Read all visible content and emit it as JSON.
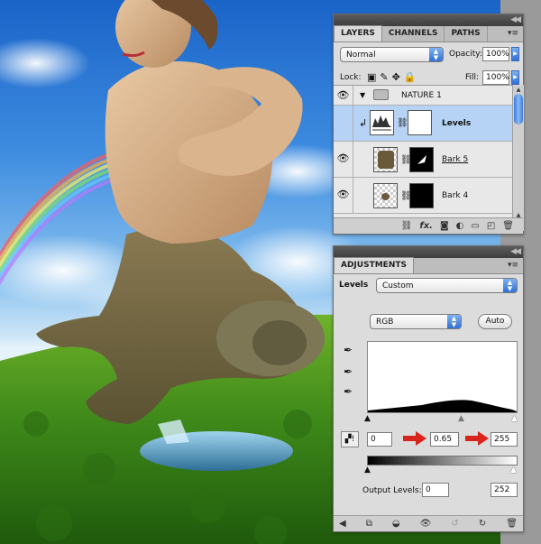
{
  "layers_panel": {
    "tabs": [
      "LAYERS",
      "CHANNELS",
      "PATHS"
    ],
    "blend_mode": "Normal",
    "opacity_label": "Opacity:",
    "opacity_value": "100%",
    "lock_label": "Lock:",
    "fill_label": "Fill:",
    "fill_value": "100%",
    "layers": [
      {
        "name": "NATURE 1",
        "type": "group",
        "visible": true
      },
      {
        "name": "Levels",
        "type": "adjustment",
        "visible": false,
        "selected": true
      },
      {
        "name": "Bark 5",
        "type": "layer",
        "visible": true
      },
      {
        "name": "Bark 4",
        "type": "layer",
        "visible": true
      }
    ],
    "fx_label": "fx."
  },
  "adjustments_panel": {
    "tab": "ADJUSTMENTS",
    "preset_label": "Levels",
    "preset_value": "Custom",
    "channel_value": "RGB",
    "auto_label": "Auto",
    "input_black": "0",
    "input_gamma": "0.65",
    "input_white": "255",
    "output_label": "Output Levels:",
    "output_black": "0",
    "output_white": "252"
  },
  "colors": {
    "selected_row": "#b6d2f5",
    "arrow_red": "#d8241c",
    "accent_blue": "#2f6fd6"
  }
}
